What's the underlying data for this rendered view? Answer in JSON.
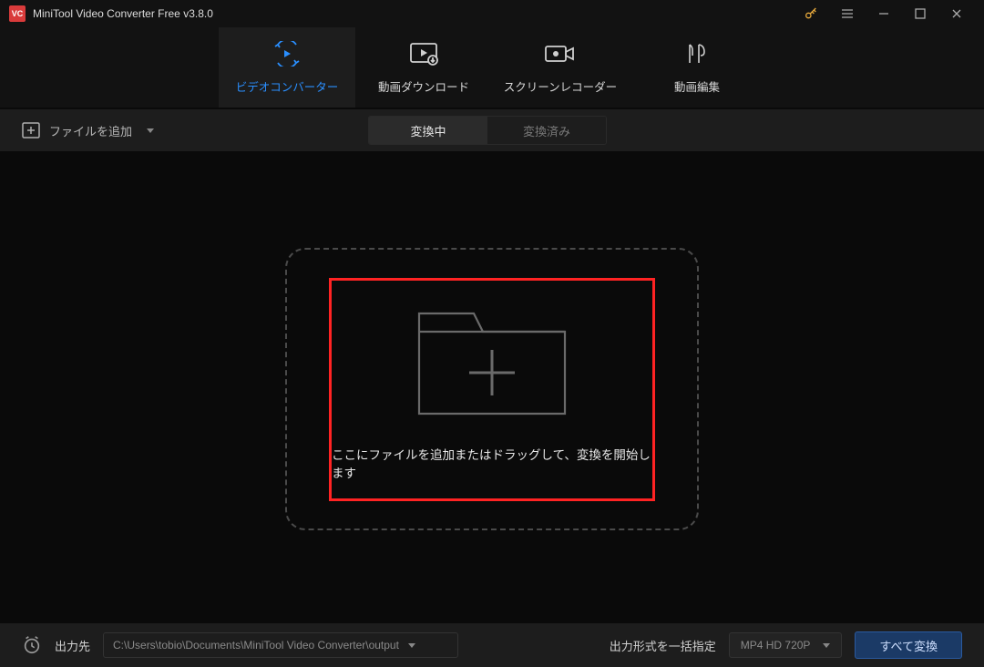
{
  "titlebar": {
    "logo_text": "VC",
    "app_title": "MiniTool Video Converter Free v3.8.0"
  },
  "tabs": [
    {
      "label": "ビデオコンバーター",
      "active": true
    },
    {
      "label": "動画ダウンロード",
      "active": false
    },
    {
      "label": "スクリーンレコーダー",
      "active": false
    },
    {
      "label": "動画編集",
      "active": false
    }
  ],
  "subbar": {
    "add_file_label": "ファイルを追加",
    "segments": [
      {
        "label": "変換中",
        "active": true
      },
      {
        "label": "変換済み",
        "active": false
      }
    ]
  },
  "dropzone": {
    "caption": "ここにファイルを追加またはドラッグして、変換を開始します"
  },
  "bottombar": {
    "output_dest_label": "出力先",
    "output_path": "C:\\Users\\tobio\\Documents\\MiniTool Video Converter\\output",
    "batch_format_label": "出力形式を一括指定",
    "format_selected": "MP4 HD 720P",
    "convert_all_label": "すべて変換"
  }
}
